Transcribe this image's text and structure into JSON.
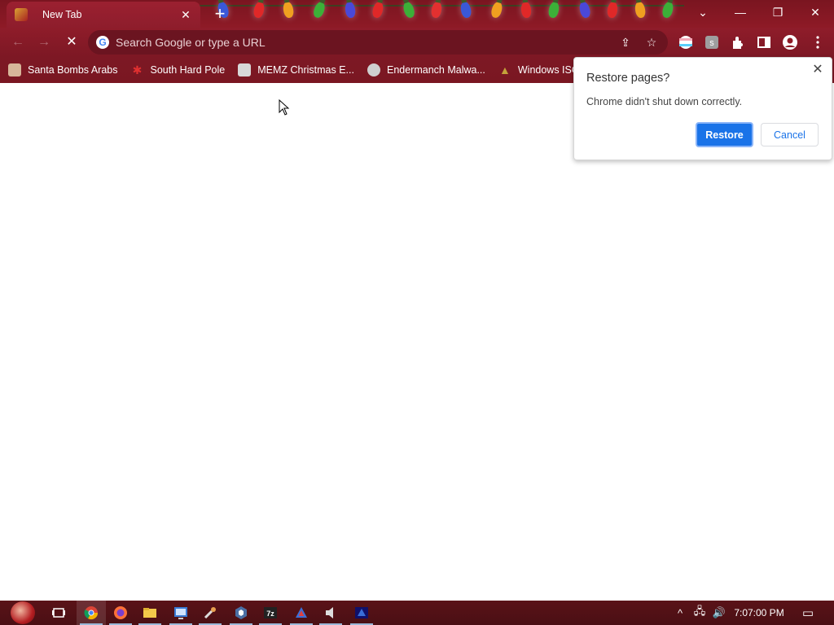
{
  "window": {
    "tab_title": "New Tab",
    "tab_close": "✕",
    "new_tab": "+",
    "controls": {
      "search_tabs": "⌄",
      "minimize": "—",
      "restore": "❐",
      "close": "✕"
    }
  },
  "toolbar": {
    "back_icon": "←",
    "forward_icon": "→",
    "reload_icon": "✕",
    "omnibox_placeholder": "Search Google or type a URL",
    "google_icon": "G",
    "share_icon": "⇪",
    "star_icon": "☆"
  },
  "bookmarks": [
    {
      "label": "Santa Bombs Arabs",
      "icon": "santa-icon",
      "color": "#d7b69a"
    },
    {
      "label": "South Hard Pole",
      "icon": "snowflake-icon",
      "color": "#d22a2a"
    },
    {
      "label": "MEMZ Christmas E...",
      "icon": "memz-icon",
      "color": "#d8d8d8"
    },
    {
      "label": "Endermanch Malwa...",
      "icon": "enderman-icon",
      "color": "#cfcfcf"
    },
    {
      "label": "Windows ISOs",
      "icon": "tree-icon",
      "color": "#c4a23a"
    }
  ],
  "dialog": {
    "title": "Restore pages?",
    "message": "Chrome didn't shut down correctly.",
    "restore_label": "Restore",
    "cancel_label": "Cancel",
    "close_icon": "✕"
  },
  "taskbar": {
    "clock": "7:07:00 PM",
    "tray_chevron": "^",
    "network_icon": "🖧",
    "volume_icon": "🔊",
    "notification_icon": "▭"
  },
  "colors": {
    "chrome_theme": "#8e1a26",
    "accent_blue": "#1a73e8",
    "taskbar": "#5a1318"
  }
}
